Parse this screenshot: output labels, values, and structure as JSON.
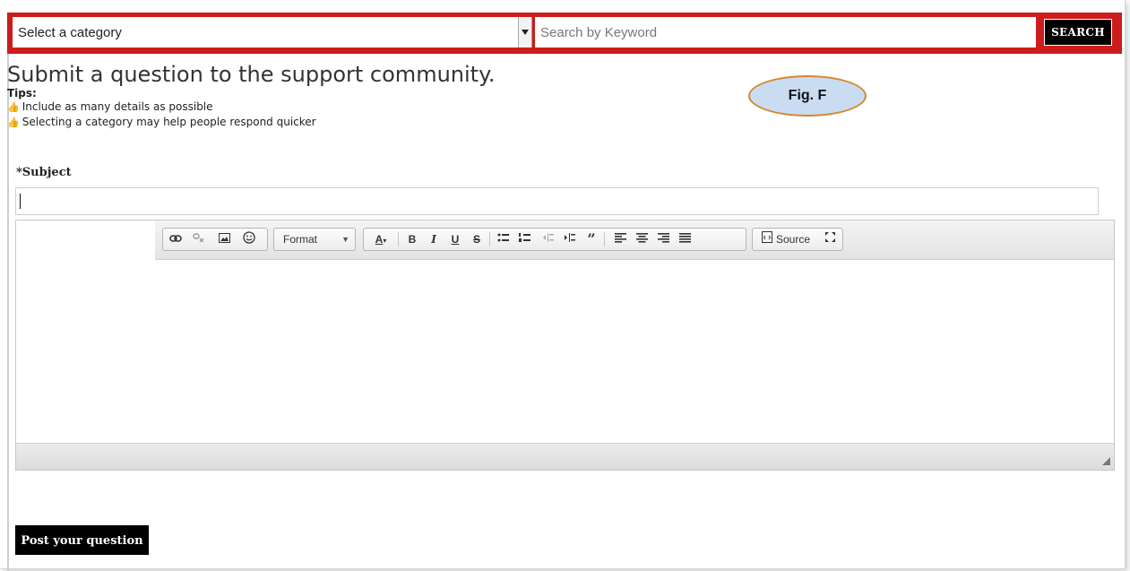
{
  "search": {
    "category_selected": "Select a category",
    "keyword_placeholder": "Search by Keyword",
    "button_label": "SEARCH"
  },
  "page": {
    "title": "Submit a question to the support community.",
    "tips_label": "Tips:",
    "tips": [
      "Include as many details as possible",
      "Selecting a category may help people respond quicker"
    ],
    "figure_label": "Fig. F"
  },
  "form": {
    "subject_label": "*Subject",
    "subject_value": "",
    "submit_label": "Post your question"
  },
  "editor": {
    "format_label": "Format",
    "source_label": "Source",
    "icons": [
      "link-icon",
      "unlink-icon",
      "image-icon",
      "smiley-icon",
      "text-color-icon",
      "bold-icon",
      "italic-icon",
      "underline-icon",
      "strikethrough-icon",
      "bulleted-list-icon",
      "numbered-list-icon",
      "outdent-icon",
      "indent-icon",
      "blockquote-icon",
      "align-left-icon",
      "align-center-icon",
      "align-right-icon",
      "justify-icon",
      "source-icon",
      "maximize-icon"
    ]
  },
  "colors": {
    "search_bar": "#cc1c1c",
    "button": "#000000",
    "badge_fill": "#c9dcf2",
    "badge_border": "#d7862c"
  }
}
